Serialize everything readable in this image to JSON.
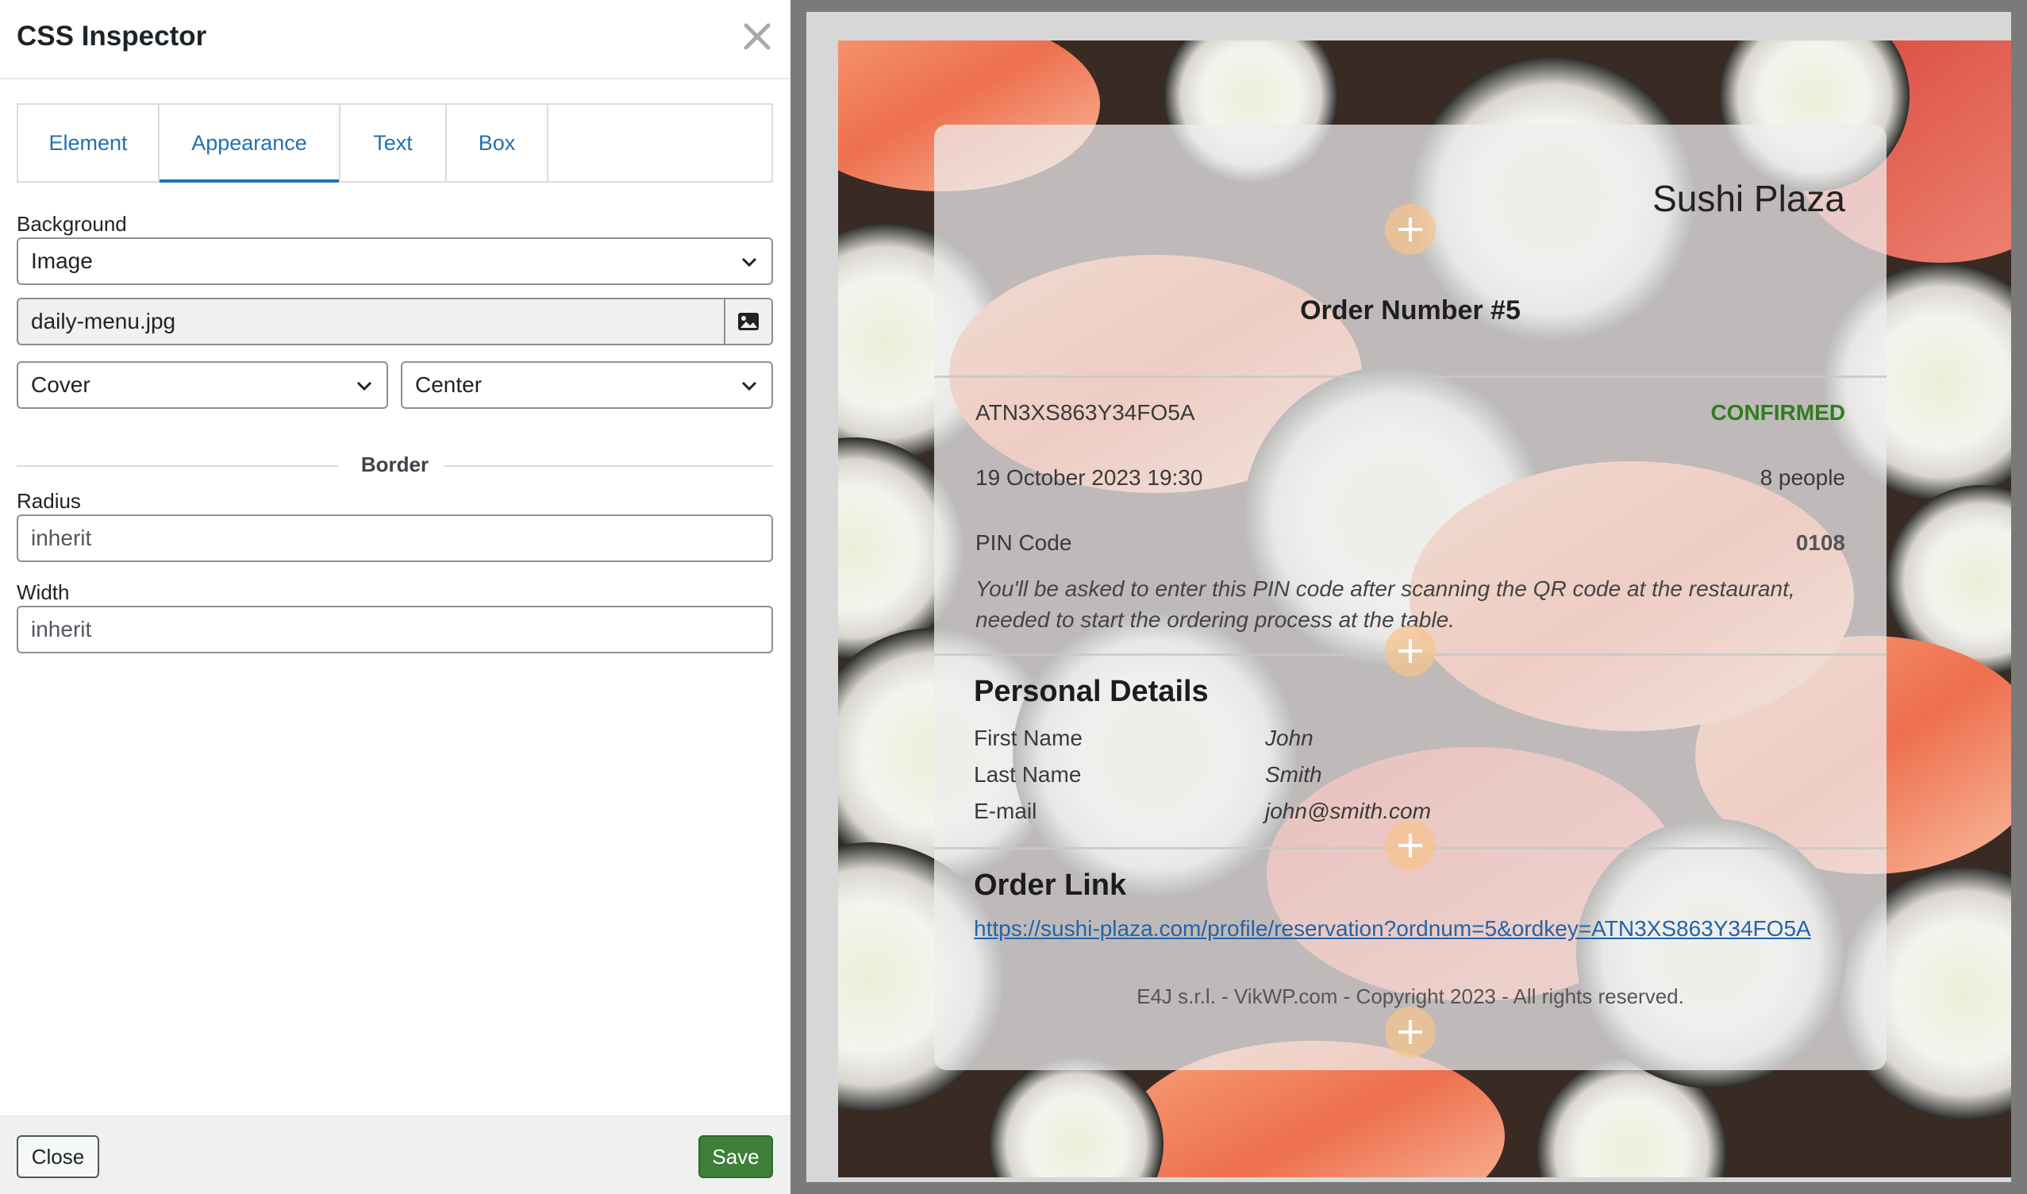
{
  "inspector": {
    "title": "CSS Inspector",
    "tabs": [
      {
        "label": "Element"
      },
      {
        "label": "Appearance"
      },
      {
        "label": "Text"
      },
      {
        "label": "Box"
      }
    ],
    "active_tab": "Appearance",
    "background": {
      "label": "Background",
      "type": "Image",
      "file": "daily-menu.jpg",
      "size": "Cover",
      "position": "Center"
    },
    "border": {
      "section_label": "Border",
      "radius_label": "Radius",
      "radius_placeholder": "inherit",
      "width_label": "Width",
      "width_placeholder": "inherit"
    },
    "footer": {
      "close_label": "Close",
      "save_label": "Save"
    }
  },
  "preview": {
    "brand": "Sushi Plaza",
    "order_title": "Order Number #5",
    "order_key": "ATN3XS863Y34FO5A",
    "status": "CONFIRMED",
    "datetime": "19 October 2023 19:30",
    "people": "8 people",
    "pin_label": "PIN Code",
    "pin_value": "0108",
    "pin_note": "You'll be asked to enter this PIN code after scanning the QR code at the restaurant, needed to start the ordering process at the table.",
    "personal": {
      "title": "Personal Details",
      "rows": [
        {
          "label": "First Name",
          "value": "John"
        },
        {
          "label": "Last Name",
          "value": "Smith"
        },
        {
          "label": "E-mail",
          "value": "john@smith.com"
        }
      ]
    },
    "link": {
      "title": "Order Link",
      "url": "https://sushi-plaza.com/profile/reservation?ordnum=5&ordkey=ATN3XS863Y34FO5A"
    },
    "footer": "E4J s.r.l. - VikWP.com - Copyright 2023 - All rights reserved."
  },
  "colors": {
    "accent": "#2271b1",
    "save_button": "#3e7f3a",
    "status_confirmed": "#2f7d1f",
    "link": "#2463a8"
  },
  "icons": [
    "close-icon",
    "chevron-down-icon",
    "image-icon",
    "plus-icon"
  ]
}
